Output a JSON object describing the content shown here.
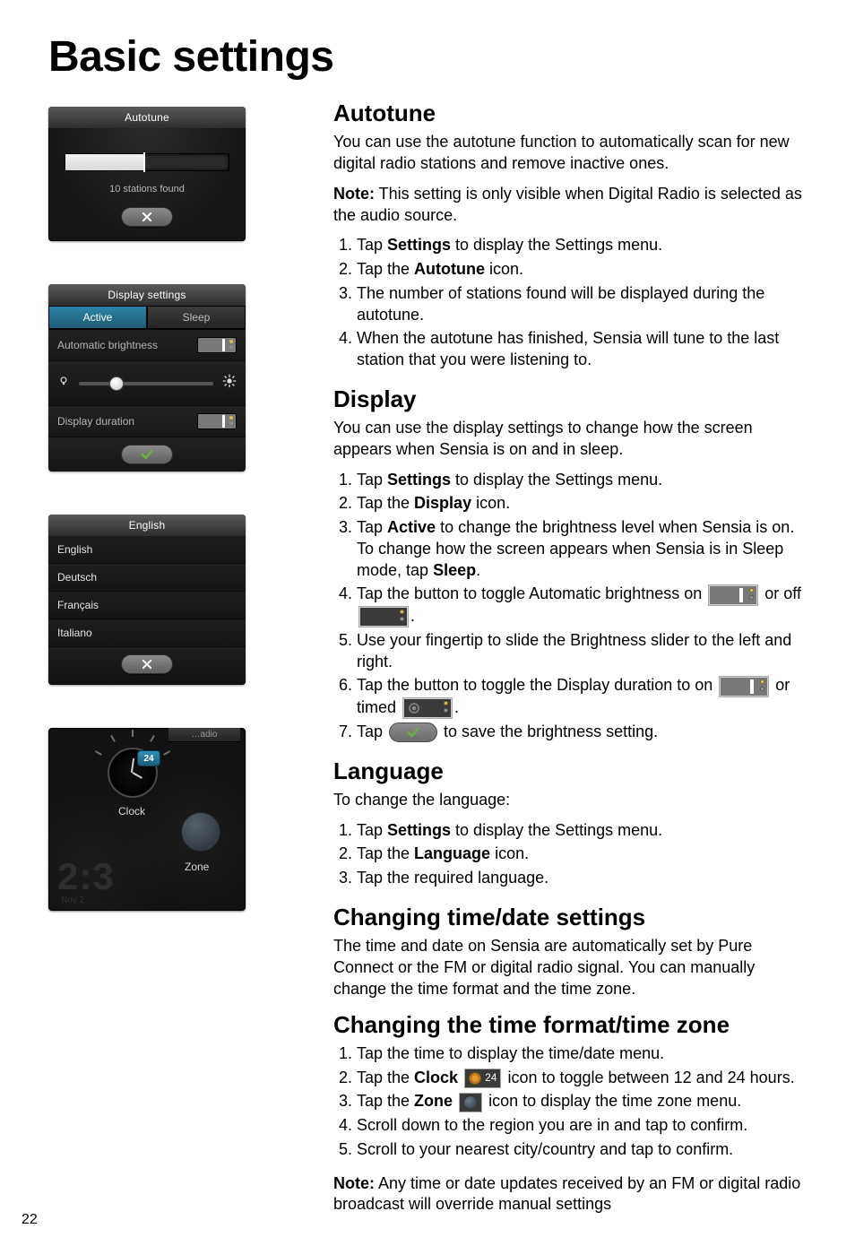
{
  "page": {
    "title": "Basic settings",
    "number": "22"
  },
  "shots": {
    "autotune": {
      "title": "Autotune",
      "status": "10 stations found",
      "progress_pct": 48
    },
    "display": {
      "title": "Display settings",
      "tabs": [
        "Active",
        "Sleep"
      ],
      "active_tab_index": 0,
      "rows": {
        "auto_brightness": "Automatic brightness",
        "display_duration": "Display duration"
      }
    },
    "language": {
      "title": "English",
      "items": [
        "English",
        "Deutsch",
        "Français",
        "Italiano"
      ]
    },
    "time": {
      "tab_label": "…adio",
      "badge": "24",
      "clock_label": "Clock",
      "zone_label": "Zone",
      "big_time": "2:3",
      "big_date": "Nov 2"
    }
  },
  "sections": {
    "autotune": {
      "heading": "Autotune",
      "intro": "You can use the autotune function to automatically scan for new digital radio stations and remove inactive ones.",
      "note_label": "Note:",
      "note_body": " This setting is only visible when Digital Radio is selected as the audio source.",
      "steps": [
        {
          "pre": "Tap ",
          "bold": "Settings",
          "post": " to display the Settings menu."
        },
        {
          "pre": "Tap the ",
          "bold": "Autotune",
          "post": " icon."
        },
        {
          "text": "The number of stations found will be displayed during the autotune."
        },
        {
          "text": "When the autotune has finished, Sensia will tune to the last station that you were listening to."
        }
      ]
    },
    "display": {
      "heading": "Display",
      "intro": "You can use the display settings to change how the screen appears when Sensia is on and in sleep.",
      "steps": {
        "s1": {
          "pre": "Tap ",
          "bold": "Settings",
          "post": " to display the Settings menu."
        },
        "s2": {
          "pre": "Tap the ",
          "bold": "Display",
          "post": " icon."
        },
        "s3": {
          "pre": "Tap ",
          "bold1": "Active",
          "mid": " to change the brightness level when Sensia is on. To change how the screen appears when Sensia is in Sleep mode, tap ",
          "bold2": "Sleep",
          "post": "."
        },
        "s4": {
          "pre": "Tap the button to toggle Automatic brightness on ",
          "mid": " or off ",
          "post": "."
        },
        "s5": {
          "text": "Use your fingertip to slide the Brightness slider to the left and right."
        },
        "s6": {
          "pre": "Tap the button to toggle the Display duration to on ",
          "mid": " or timed ",
          "post": "."
        },
        "s7": {
          "pre": "Tap ",
          "post": " to save the brightness setting."
        }
      }
    },
    "language": {
      "heading": "Language",
      "intro": "To change the language:",
      "steps": [
        {
          "pre": "Tap ",
          "bold": "Settings",
          "post": " to display the Settings menu."
        },
        {
          "pre": "Tap the ",
          "bold": "Language",
          "post": " icon."
        },
        {
          "text": "Tap the required language."
        }
      ]
    },
    "timedate": {
      "heading": "Changing time/date settings",
      "intro": "The time and date on Sensia are automatically set by Pure Connect or the FM or digital radio signal. You can manually change the time format and the time zone."
    },
    "timefmt": {
      "heading": "Changing the time format/time zone",
      "steps": {
        "s1": {
          "text": "Tap the time to display the time/date menu."
        },
        "s2": {
          "pre": "Tap the ",
          "bold": "Clock",
          "chip_label": "24",
          "post": " icon to toggle between 12 and 24 hours."
        },
        "s3": {
          "pre": "Tap the ",
          "bold": "Zone",
          "post": " icon  to display the time zone menu."
        },
        "s4": {
          "text": "Scroll down to the region you are in and tap to confirm."
        },
        "s5": {
          "text": "Scroll to your nearest city/country and tap to confirm."
        }
      },
      "note_label": "Note:",
      "note_body": " Any time or date updates received by an FM or digital radio broadcast will override manual settings"
    }
  }
}
